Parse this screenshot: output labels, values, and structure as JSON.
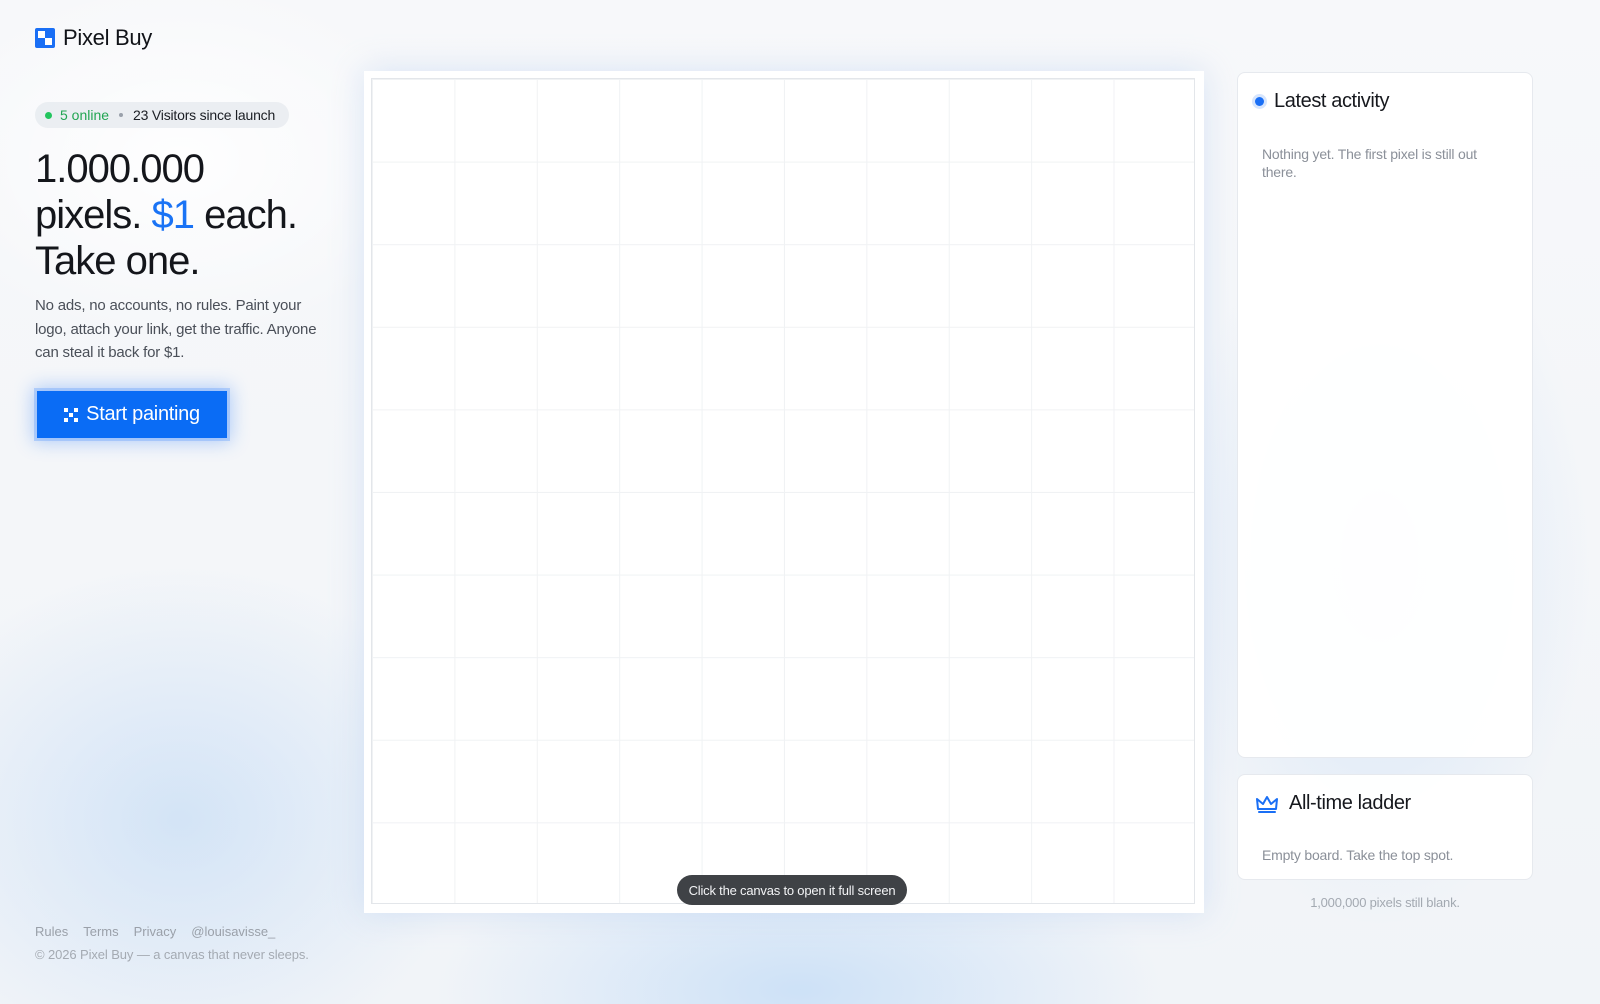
{
  "brand": {
    "name": "Pixel Buy",
    "accent_color": "#1a73f5",
    "icon": "pixel-logo-icon"
  },
  "status": {
    "online": "5 online",
    "visitors": "23 Visitors since launch",
    "online_color": "#22c55e"
  },
  "hero": {
    "line1": "1.000.000",
    "line2_pre": "pixels. ",
    "price": "$1",
    "line2_post": " each.",
    "line3": "Take one."
  },
  "description": "No ads, no accounts, no rules. Paint your logo, attach your link, get the traffic. Anyone can steal it back for $1.",
  "cta": {
    "label": "Start painting",
    "icon": "pixel-grid-icon",
    "color": "#0a6cf5"
  },
  "canvas": {
    "hint": "Click the canvas to open it full screen"
  },
  "activity": {
    "title": "Latest activity",
    "empty": "Nothing yet. The first pixel is still out there."
  },
  "ladder": {
    "title": "All-time ladder",
    "icon": "crown-icon",
    "empty": "Empty board. Take the top spot."
  },
  "blank_note": "1,000,000 pixels still blank.",
  "footer": {
    "links": [
      "Rules",
      "Terms",
      "Privacy",
      "@louisavisse_"
    ],
    "copyright": "© 2026 Pixel Buy — a canvas that never sleeps."
  }
}
